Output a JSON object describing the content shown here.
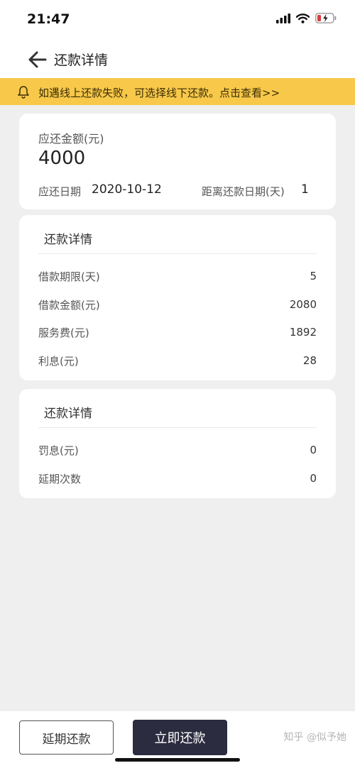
{
  "status_bar": {
    "time": "21:47"
  },
  "nav": {
    "title": "还款详情"
  },
  "notice": {
    "text": "如遇线上还款失败，可选择线下还款。点击查看>>"
  },
  "summary": {
    "amount_label": "应还金额(元)",
    "amount_value": "4000",
    "due_date_label": "应还日期",
    "due_date_value": "2020-10-12",
    "days_left_label": "距离还款日期(天)",
    "days_left_value": "1"
  },
  "detail_card": {
    "title": "还款详情",
    "rows": [
      {
        "label": "借款期限(天)",
        "value": "5"
      },
      {
        "label": "借款金额(元)",
        "value": "2080"
      },
      {
        "label": "服务费(元)",
        "value": "1892"
      },
      {
        "label": "利息(元)",
        "value": "28"
      }
    ]
  },
  "penalty_card": {
    "title": "还款详情",
    "rows": [
      {
        "label": "罚息(元)",
        "value": "0"
      },
      {
        "label": "延期次数",
        "value": "0"
      }
    ]
  },
  "bottom": {
    "extend_label": "延期还款",
    "pay_label": "立即还款",
    "watermark": "知乎 @似予她"
  },
  "colors": {
    "notice_bg": "#f7c84a",
    "pay_button_bg": "#2c2c40",
    "page_bg": "#efeff0",
    "battery_low": "#e03b3b"
  },
  "icons": {
    "back": "arrow-left-icon",
    "bell": "bell-icon",
    "signal": "cellular-signal-icon",
    "wifi": "wifi-icon",
    "battery": "battery-charging-icon"
  }
}
